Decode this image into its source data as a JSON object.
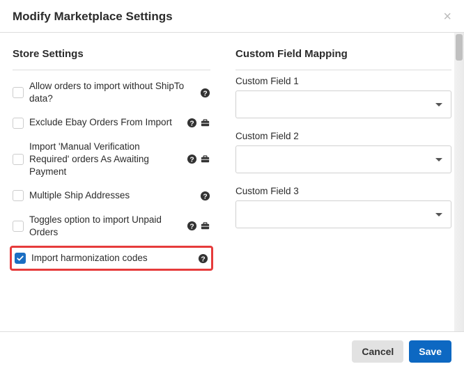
{
  "modal": {
    "title": "Modify Marketplace Settings"
  },
  "storeSettings": {
    "heading": "Store Settings",
    "items": [
      {
        "label": "Allow orders to import without ShipTo data?",
        "checked": false,
        "help": true,
        "briefcase": false
      },
      {
        "label": "Exclude Ebay Orders From Import",
        "checked": false,
        "help": true,
        "briefcase": true
      },
      {
        "label": "Import 'Manual Verification Required' orders As Awaiting Payment",
        "checked": false,
        "help": true,
        "briefcase": true
      },
      {
        "label": "Multiple Ship Addresses",
        "checked": false,
        "help": true,
        "briefcase": false
      },
      {
        "label": "Toggles option to import Unpaid Orders",
        "checked": false,
        "help": true,
        "briefcase": true
      },
      {
        "label": "Import harmonization codes",
        "checked": true,
        "help": true,
        "briefcase": false,
        "highlight": true
      }
    ]
  },
  "customFieldMapping": {
    "heading": "Custom Field Mapping",
    "fields": [
      {
        "label": "Custom Field 1",
        "value": ""
      },
      {
        "label": "Custom Field 2",
        "value": ""
      },
      {
        "label": "Custom Field 3",
        "value": ""
      }
    ]
  },
  "footer": {
    "cancel": "Cancel",
    "save": "Save"
  }
}
